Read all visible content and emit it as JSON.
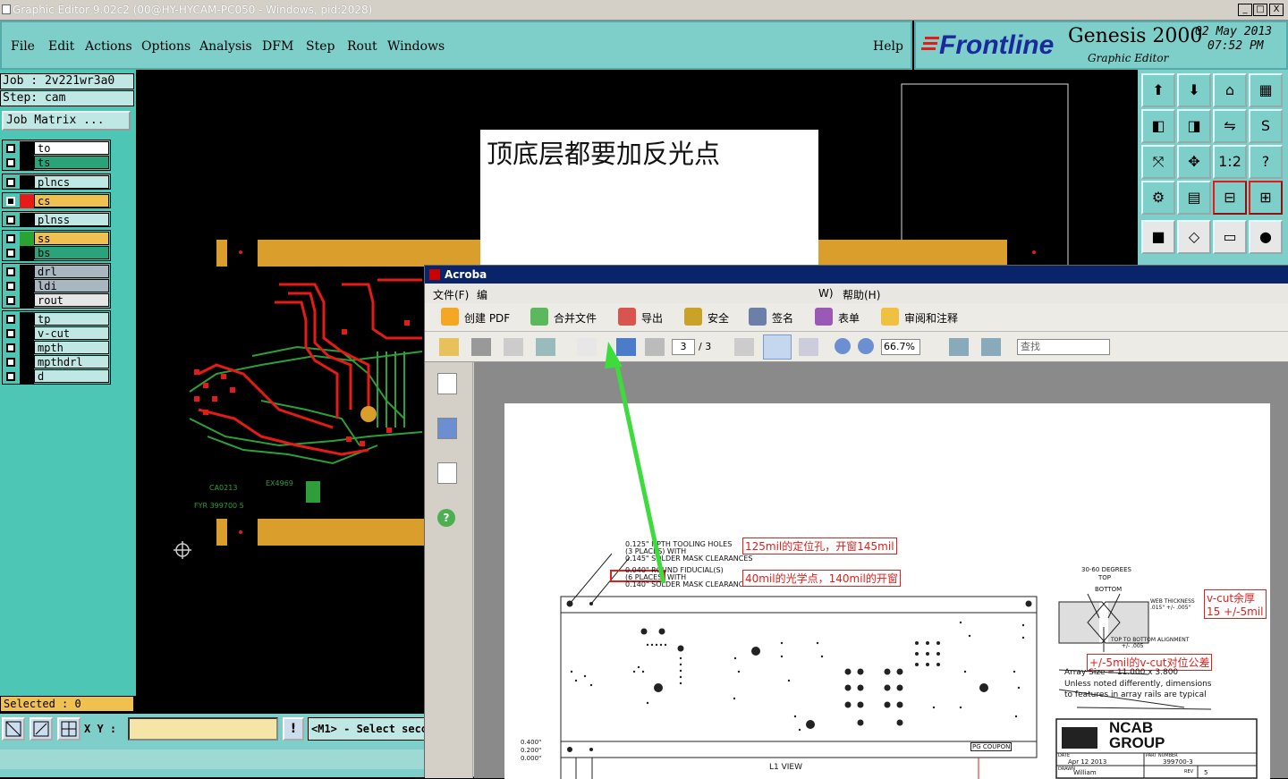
{
  "window": {
    "title": "Graphic Editor 9.02c2 (00@HY-HYCAM-PC050 - Windows, pid:2028)",
    "buttons": [
      "_",
      "□",
      "X"
    ]
  },
  "menu": {
    "items": [
      "File",
      "Edit",
      "Actions",
      "Options",
      "Analysis",
      "DFM",
      "Step",
      "Rout",
      "Windows"
    ],
    "help": "Help"
  },
  "brand": {
    "logo": "Frontline",
    "product": "Genesis 2000",
    "subtitle": "Graphic Editor",
    "date": "02 May 2013",
    "time": "07:52 PM"
  },
  "job": {
    "job_line": "Job : 2v221wr3a0",
    "step_line": "Step: cam",
    "matrix_button": "Job Matrix ..."
  },
  "layers": [
    {
      "name": "to",
      "name_bg": "#ffffff",
      "swatch": "#000000"
    },
    {
      "name": "ts",
      "name_bg": "#2aa37a",
      "swatch": "#000000"
    },
    {
      "name": "plncs",
      "name_bg": "#bfe8e4",
      "swatch": "#000000"
    },
    {
      "name": "cs",
      "name_bg": "#f0c050",
      "swatch": "#e41b17",
      "active": true
    },
    {
      "name": "plnss",
      "name_bg": "#bfe8e4",
      "swatch": "#000000"
    },
    {
      "name": "ss",
      "name_bg": "#f0c050",
      "swatch": "#2aa330"
    },
    {
      "name": "bs",
      "name_bg": "#2aa37a",
      "swatch": "#000000"
    },
    {
      "name": "drl",
      "name_bg": "#a9b8c0",
      "swatch": "#000000"
    },
    {
      "name": "ldi",
      "name_bg": "#a9b8c0",
      "swatch": "#000000"
    },
    {
      "name": "rout",
      "name_bg": "#e6e6e6",
      "swatch": "#000000"
    },
    {
      "name": "tp",
      "name_bg": "#bfe8e4",
      "swatch": "#000000"
    },
    {
      "name": "v-cut",
      "name_bg": "#bfe8e4",
      "swatch": "#000000"
    },
    {
      "name": "mpth",
      "name_bg": "#bfe8e4",
      "swatch": "#000000"
    },
    {
      "name": "mpthdrl",
      "name_bg": "#bfe8e4",
      "swatch": "#000000"
    },
    {
      "name": "d",
      "name_bg": "#bfe8e4",
      "swatch": "#000000"
    }
  ],
  "status": {
    "selected": "Selected : 0",
    "xy_label": "X Y :",
    "xy_value": "",
    "message": "<M1> - Select seco"
  },
  "note": {
    "text": "顶底层都要加反光点"
  },
  "acrobat": {
    "title": "Acroba",
    "menu": [
      "文件(F)",
      "编",
      "W)",
      "帮助(H)"
    ],
    "toolbar": [
      "创建 PDF",
      "合并文件",
      "导出",
      "安全",
      "签名",
      "表单",
      "审阅和注释"
    ],
    "page_current": "3",
    "page_total": "/ 3",
    "zoom": "66.7%",
    "find_placeholder": "查找"
  },
  "drawing": {
    "tooling_lines": [
      "0.125\" NPTH TOOLING HOLES",
      "(3 PLACES) WITH",
      "0.145\" SOLDER MASK CLEARANCES"
    ],
    "fiducial_lines": [
      "0.040\" ROUND FIDUCIAL(S)",
      "(6 PLACES) WITH",
      "0.140\" SOLDER MASK CLEARANCES"
    ],
    "annotations": [
      "125mil的定位孔，开窗145mil",
      "40mil的光学点，140mil的开窗",
      "v-cut余厚15 +/-5mil",
      "+/-5mil的v-cut对位公差"
    ],
    "degrees": "30-60 DEGREES",
    "top": "TOP",
    "bottom": "BOTTOM",
    "web": "WEB THICKNESS",
    "web_val": ".015\" +/- .005\"",
    "align": "TOP TO BOTTOM ALIGNMENT",
    "align_val": "+/- .005",
    "array_size": "Array Size = 11.000 x 3.800",
    "unless1": "Unless noted differently, dimensions",
    "unless2": "to features in array rails are typical",
    "dims": [
      "0.400\"",
      "0.200\"",
      "0.000\""
    ],
    "view": "L1 VIEW",
    "coupon": "PG COUPON",
    "company": "NCAB",
    "company2": "GROUP",
    "date_label": "DATE",
    "date_val": "Apr 12 2013",
    "part_label": "PART NUMBER",
    "part_val": "399700-3",
    "drawn_label": "DRAWN",
    "drawn_val": "William",
    "rev_label": "REV",
    "rev_val": "5"
  }
}
